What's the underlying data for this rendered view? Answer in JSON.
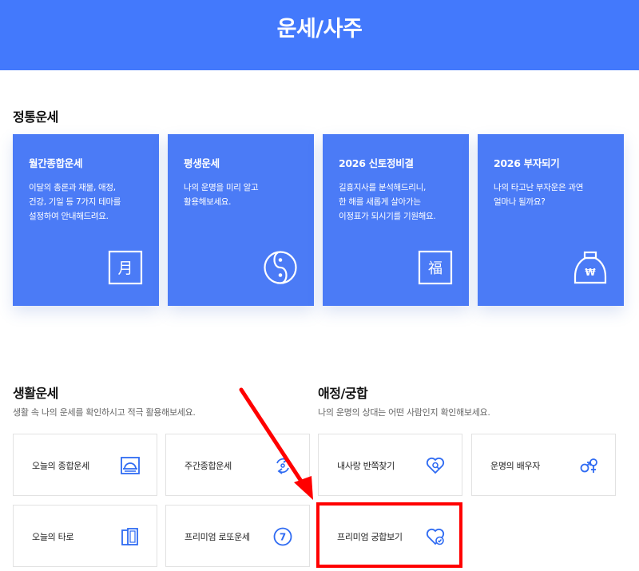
{
  "header": {
    "title": "운세/사주"
  },
  "traditional": {
    "heading": "정통운세",
    "cards": [
      {
        "title": "월간종합운세",
        "desc": "이달의 총론과 재물, 애정,\n건강, 기일 등 7가지 테마를\n설정하여 안내해드려요.",
        "icon": "calendar-month-icon",
        "glyph": "月"
      },
      {
        "title": "평생운세",
        "desc": "나의 운명을 미리 알고\n활용해보세요.",
        "icon": "yin-yang-icon"
      },
      {
        "title": "2026 신토정비결",
        "desc": "길흉지사를 분석해드리니,\n한 해를 새롭게 살아가는\n이정표가 되시기를 기원해요.",
        "icon": "fortune-bok-icon",
        "glyph": "福"
      },
      {
        "title": "2026 부자되기",
        "desc": "나의 타고난 부자운은 과연\n얼마나 될까요?",
        "icon": "money-bag-icon",
        "glyph": "₩"
      }
    ]
  },
  "life": {
    "heading": "생활운세",
    "subtitle": "생활 속 나의 운세를 확인하시고 적극 활용해보세요.",
    "items": [
      {
        "label": "오늘의 종합운세",
        "icon": "sunrise-frame-icon"
      },
      {
        "label": "주간종합운세",
        "icon": "refresh-cycle-icon"
      },
      {
        "label": "오늘의 타로",
        "icon": "tarot-cards-icon"
      },
      {
        "label": "프리미엄 로또운세",
        "icon": "lotto-ball-icon",
        "glyph": "7"
      }
    ]
  },
  "love": {
    "heading": "애정/궁합",
    "subtitle": "나의 운명의 상대는 어떤 사람인지 확인해보세요.",
    "items": [
      {
        "label": "내사랑 반쪽찾기",
        "icon": "heart-search-icon"
      },
      {
        "label": "운명의 배우자",
        "icon": "gender-symbols-icon"
      },
      {
        "label": "프리미엄 궁합보기",
        "icon": "heart-check-icon"
      }
    ]
  },
  "colors": {
    "header_bg": "#4379fc",
    "card_bg": "#4b7bf6",
    "icon_blue": "#2f6bf2",
    "annotation_red": "#ff0000"
  }
}
